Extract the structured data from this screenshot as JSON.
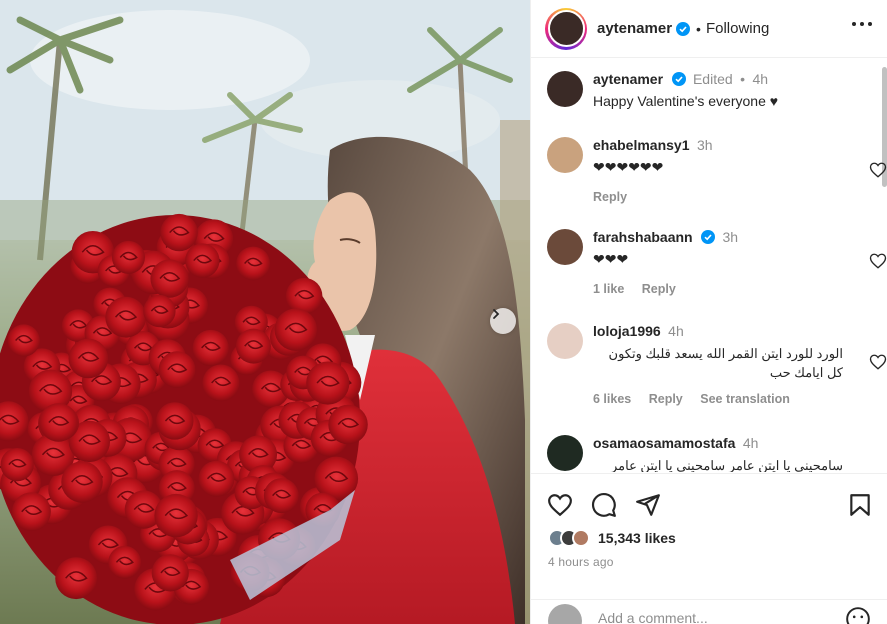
{
  "post": {
    "author": "aytenamer",
    "follow_status": "Following",
    "separator": "•",
    "caption": {
      "username": "aytenamer",
      "status": "Edited",
      "dot": "•",
      "time": "4h",
      "text": "Happy Valentine's everyone ♥"
    },
    "comments": [
      {
        "username": "ehabelmansy1",
        "verified": false,
        "time": "3h",
        "text": "❤❤❤❤❤❤",
        "likes": "",
        "reply": "Reply",
        "translate": ""
      },
      {
        "username": "farahshabaann",
        "verified": true,
        "time": "3h",
        "text": "❤❤❤",
        "likes": "1 like",
        "reply": "Reply",
        "translate": ""
      },
      {
        "username": "loloja1996",
        "verified": false,
        "time": "4h",
        "text": "الورد للورد ايتن القمر الله يسعد قلبك وتكون كل ايامك حب",
        "likes": "6 likes",
        "reply": "Reply",
        "translate": "See translation"
      },
      {
        "username": "osamaosamamostafa",
        "verified": false,
        "time": "4h",
        "text": "سامحيني يا ايتن عامر سامحيني يا ايتن عامر",
        "likes": "",
        "reply": "",
        "translate": ""
      }
    ],
    "likes_count": "15,343 likes",
    "posted_ago": "4 hours ago",
    "add_comment_placeholder": "Add a comment..."
  },
  "icons": {
    "verified": "verified-badge-icon",
    "more": "more-options-icon",
    "like": "heart-icon",
    "comment": "comment-icon",
    "share": "share-icon",
    "save": "bookmark-icon",
    "next": "chevron-right-icon",
    "emoji": "emoji-icon"
  },
  "colors": {
    "verified_blue": "#0095f6",
    "text_primary": "#262626",
    "text_secondary": "#8e8e8e",
    "rose_red": "#c4141c",
    "coat_red": "#d81f2b"
  }
}
